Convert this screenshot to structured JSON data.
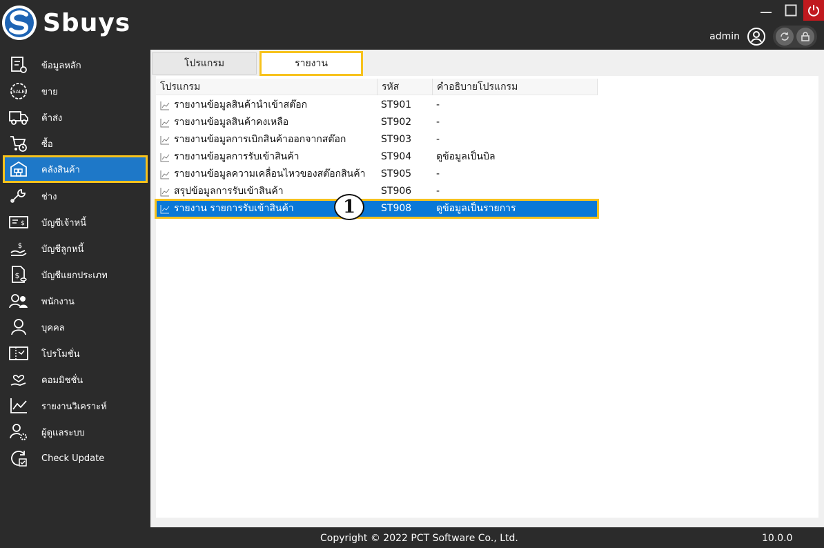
{
  "app": {
    "name": "Sbuys"
  },
  "window": {
    "minimize": "minimize",
    "maximize": "maximize",
    "power": "power"
  },
  "user": {
    "name": "admin"
  },
  "sidebar": {
    "items": [
      {
        "label": "ข้อมูลหลัก",
        "icon": "settings-doc-icon"
      },
      {
        "label": "ขาย",
        "icon": "sale-badge-icon"
      },
      {
        "label": "ค้าส่ง",
        "icon": "truck-icon"
      },
      {
        "label": "ซื้อ",
        "icon": "cart-clock-icon"
      },
      {
        "label": "คลังสินค้า",
        "icon": "warehouse-icon"
      },
      {
        "label": "ช่าง",
        "icon": "wrench-icon"
      },
      {
        "label": "บัญชีเจ้าหนี้",
        "icon": "invoice-icon"
      },
      {
        "label": "บัญชีลูกหนี้",
        "icon": "hand-money-icon"
      },
      {
        "label": "บัญชีแยกประเภท",
        "icon": "ledger-icon"
      },
      {
        "label": "พนักงาน",
        "icon": "employees-icon"
      },
      {
        "label": "บุคคล",
        "icon": "person-icon"
      },
      {
        "label": "โปรโมชั่น",
        "icon": "promotion-icon"
      },
      {
        "label": "คอมมิชชั่น",
        "icon": "commission-icon"
      },
      {
        "label": "รายงานวิเคราะห์",
        "icon": "analytics-icon"
      },
      {
        "label": "ผู้ดูแลระบบ",
        "icon": "admin-gear-icon"
      },
      {
        "label": "Check Update",
        "icon": "check-update-icon"
      }
    ]
  },
  "tabs": [
    {
      "label": "โปรแกรม"
    },
    {
      "label": "รายงาน"
    }
  ],
  "table": {
    "headers": {
      "program": "โปรแกรม",
      "code": "รหัส",
      "description": "คำอธิบายโปรแกรม"
    },
    "rows": [
      {
        "program": "รายงานข้อมูลสินค้านำเข้าสต๊อก",
        "code": "ST901",
        "description": "-"
      },
      {
        "program": "รายงานข้อมูลสินค้าคงเหลือ",
        "code": "ST902",
        "description": "-"
      },
      {
        "program": "รายงานข้อมูลการเบิกสินค้าออกจากสต๊อก",
        "code": "ST903",
        "description": "-"
      },
      {
        "program": "รายงานข้อมูลการรับเข้าสินค้า",
        "code": "ST904",
        "description": "ดูข้อมูลเป็นบิล"
      },
      {
        "program": "รายงานข้อมูลความเคลื่อนไหวของสต๊อกสินค้า",
        "code": "ST905",
        "description": "-"
      },
      {
        "program": "สรุปข้อมูลการรับเข้าสินค้า",
        "code": "ST906",
        "description": "-"
      },
      {
        "program": "รายงาน รายการรับเข้าสินค้า",
        "code": "ST908",
        "description": "ดูข้อมูลเป็นรายการ"
      }
    ]
  },
  "annotation": {
    "step": "1"
  },
  "footer": {
    "copyright": "Copyright © 2022 PCT Software Co., Ltd.",
    "version": "10.0.0"
  },
  "colors": {
    "sidebar_bg": "#2b2b2b",
    "active": "#1e78c8",
    "highlight": "#f7c21c",
    "selected_row": "#0a78d7",
    "power": "#c0191e"
  }
}
